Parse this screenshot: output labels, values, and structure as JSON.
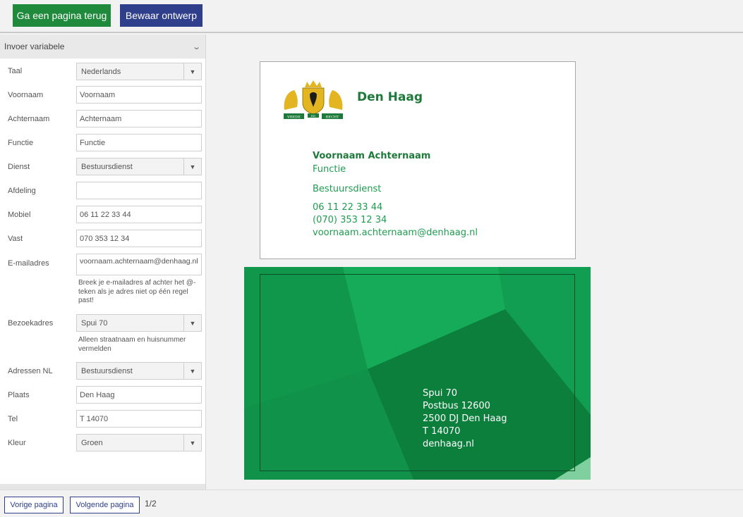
{
  "toolbar": {
    "back_label": "Ga een pagina terug",
    "save_label": "Bewaar ontwerp",
    "back_color": "#1f8a3b",
    "save_color": "#2f3f8c"
  },
  "panel": {
    "title": "Invoer variabele",
    "fields": {
      "taal": {
        "label": "Taal",
        "value": "Nederlands"
      },
      "voornaam": {
        "label": "Voornaam",
        "value": "Voornaam"
      },
      "achternaam": {
        "label": "Achternaam",
        "value": "Achternaam"
      },
      "functie": {
        "label": "Functie",
        "value": "Functie"
      },
      "dienst": {
        "label": "Dienst",
        "value": "Bestuursdienst"
      },
      "afdeling": {
        "label": "Afdeling",
        "value": ""
      },
      "mobiel": {
        "label": "Mobiel",
        "value": "06 11 22 33 44"
      },
      "vast": {
        "label": "Vast",
        "value": "070 353 12 34"
      },
      "email": {
        "label": "E-mailadres",
        "value": "voornaam.achternaam@denhaag.nl",
        "hint": "Breek je e-mailadres af achter het @-teken als je adres niet op één regel past!"
      },
      "bezoekadres": {
        "label": "Bezoekadres",
        "value": "Spui 70",
        "hint": "Alleen straatnaam en huisnummer vermelden"
      },
      "adressen": {
        "label": "Adressen NL",
        "value": "Bestuursdienst"
      },
      "plaats": {
        "label": "Plaats",
        "value": "Den Haag"
      },
      "tel": {
        "label": "Tel",
        "value": "T 14070"
      },
      "kleur": {
        "label": "Kleur",
        "value": "Groen"
      }
    }
  },
  "front": {
    "org": "Den Haag",
    "motto_left": "VREDE",
    "motto_mid": "ED",
    "motto_right": "RECHT",
    "name": "Voornaam Achternaam",
    "function": "Functie",
    "department": "Bestuursdienst",
    "mobile": "06 11 22 33 44",
    "phone": "(070) 353  12 34",
    "email": "voornaam.achternaam@denhaag.nl"
  },
  "back": {
    "street": "Spui 70",
    "postbus": "Postbus 12600",
    "postcode": "2500 DJ Den Haag",
    "tel": "T  14070",
    "web": "denhaag.nl",
    "color": "#13a354"
  },
  "pager": {
    "prev_label": "Vorige pagina",
    "next_label": "Volgende pagina",
    "page": "1/2"
  }
}
